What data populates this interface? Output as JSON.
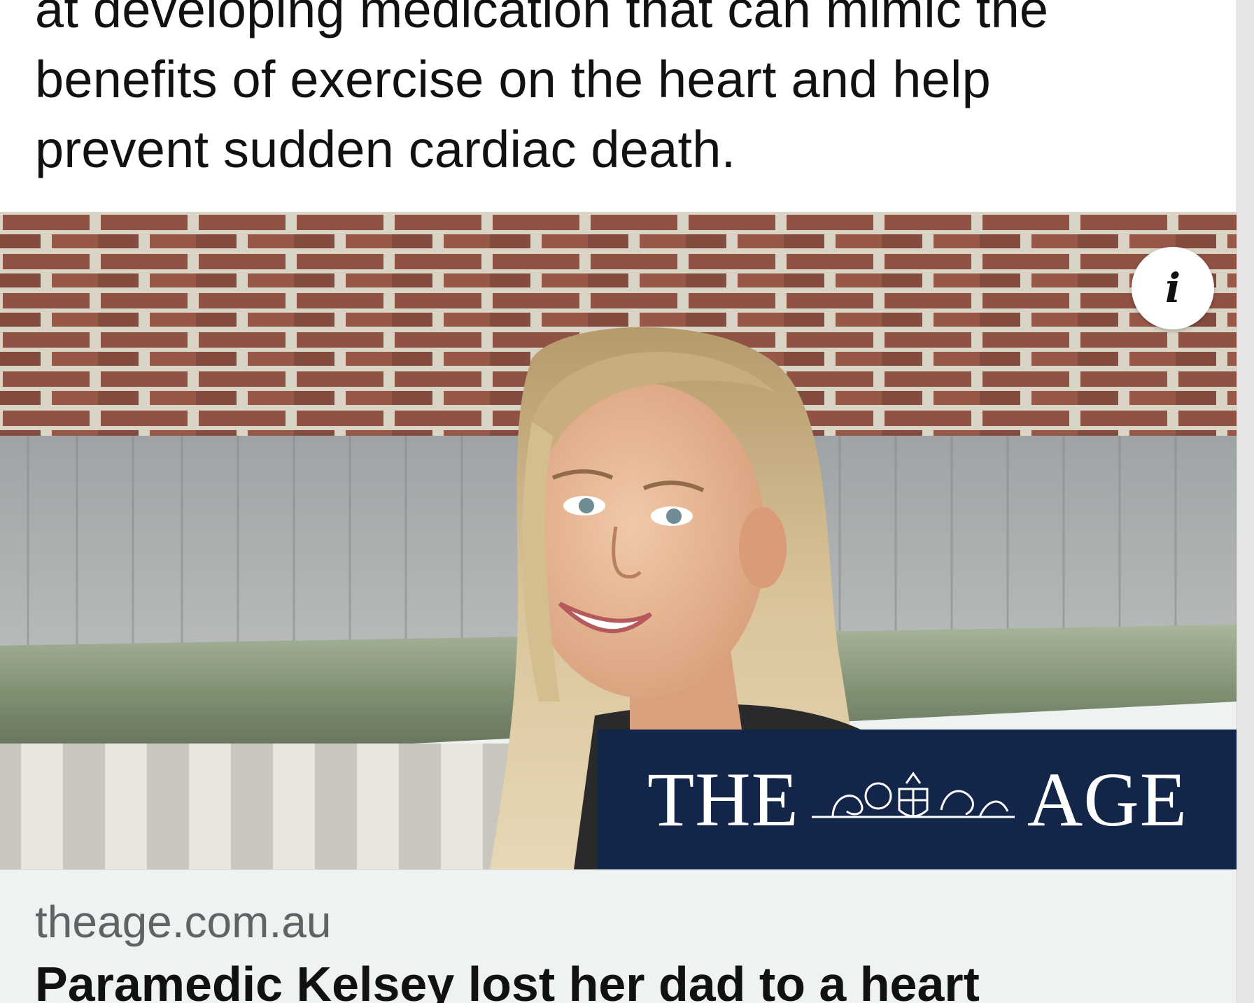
{
  "post": {
    "text_lines": [
      "at developing medication that can mimic the",
      "benefits of exercise on the heart and help",
      "prevent sudden cardiac death."
    ]
  },
  "link_preview": {
    "info_icon": "info-icon",
    "image_subject": "photo-of-smiling-woman",
    "masthead": {
      "left_word": "THE",
      "right_word": "AGE",
      "crest_icon": "coat-of-arms-icon",
      "background_color": "#14254a"
    },
    "domain": "theage.com.au",
    "headline": "Paramedic Kelsey lost her dad to a heart"
  }
}
